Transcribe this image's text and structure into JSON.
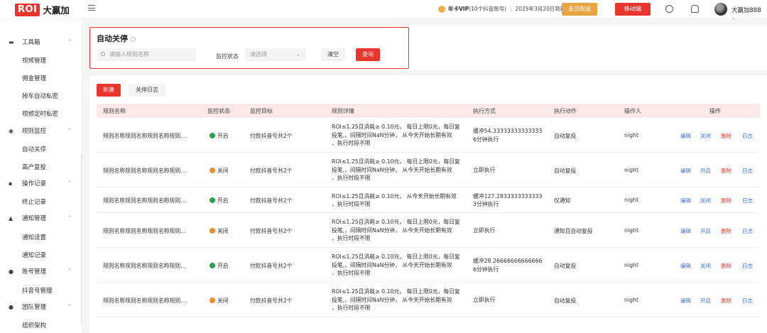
{
  "header": {
    "logo_badge": "ROI",
    "logo_text": "大赢加",
    "vip_label": "年卡VIP",
    "vip_accounts": "(10个抖音账号)",
    "vip_expiry": "2025年3月20日到期",
    "member_rights_btn": "会员权益",
    "mobile_btn": "移动端",
    "username": "大赢加888"
  },
  "sidebar": {
    "groups": [
      {
        "label": "工具箱",
        "items": [
          "视频管理",
          "佣金管理",
          "掉车自动私密",
          "视频定时私密"
        ]
      },
      {
        "label": "规则监控",
        "items": [
          "自动关停",
          "高产复投"
        ]
      },
      {
        "label": "操作记录",
        "items": [
          "终止记录"
        ]
      },
      {
        "label": "通知管理",
        "items": [
          "通知设置",
          "通知记录"
        ]
      },
      {
        "label": "账号管理",
        "items": [
          "抖音号管理"
        ]
      },
      {
        "label": "团队管理",
        "items": [
          "组织架构"
        ]
      }
    ]
  },
  "filter": {
    "title": "自动关停",
    "search_placeholder": "请输入规则名称",
    "status_label": "监控状态",
    "status_placeholder": "请选择",
    "clear_btn": "清空",
    "query_btn": "查询"
  },
  "toolbar": {
    "new_btn": "新建",
    "log_btn": "关停日志"
  },
  "table": {
    "headers": [
      "规则名称",
      "监控状态",
      "监控目标",
      "规则详情",
      "执行方式",
      "执行动作",
      "操作人",
      "操作"
    ],
    "rows": [
      {
        "name": "规则名称规则名称规则名称规则...",
        "status": "开启",
        "status_on": true,
        "target": "付款抖音号共2个",
        "detail_lines": [
          "ROI≤1.25且消耗≥ 0.10元， 每日上限0元，每日复",
          "投笔,，间隔时间NaN分钟， 从今天开始长期有效",
          "，执行时段不限"
        ],
        "exec_lines": [
          "缓冲54.33333333333333",
          "6分钟执行"
        ],
        "action": "自动复投",
        "operator": "night",
        "ops": [
          "编辑",
          "关闭",
          "删除",
          "日志"
        ]
      },
      {
        "name": "规则名称规则名称规则名称规则...",
        "status": "关闭",
        "status_on": false,
        "target": "付款抖音号共2个",
        "detail_lines": [
          "ROI≤1.25且消耗≥ 0.10元， 每日上限0元，每日复",
          "投笔,，间隔时间NaN分钟， 从今天开始长期有效",
          "，执行时段不限"
        ],
        "exec_lines": [
          "立即执行"
        ],
        "action": "自动复投",
        "operator": "night",
        "ops": [
          "编辑",
          "开启",
          "删除",
          "日志"
        ]
      },
      {
        "name": "规则名称规则名称规则名称规则...",
        "status": "开启",
        "status_on": true,
        "target": "付款抖音号共2个",
        "detail_lines": [
          "ROI≤1.25且消耗≥ 0.10元， 从今天开始长期有效",
          "，执行时段不限"
        ],
        "exec_lines": [
          "缓冲127.2833333333333",
          "3分钟执行"
        ],
        "action": "仅通知",
        "operator": "night",
        "ops": [
          "编辑",
          "关闭",
          "删除",
          "日志"
        ]
      },
      {
        "name": "规则名称规则名称规则名称规则...",
        "status": "关闭",
        "status_on": false,
        "target": "付款抖音号共2个",
        "detail_lines": [
          "ROI≤1.25且消耗≥ 0.10元， 每日上限0元，每日复",
          "投笔,，间隔时间NaN分钟， 从今天开始长期有效",
          "，执行时段不限"
        ],
        "exec_lines": [
          "立即执行"
        ],
        "action": "通知且自动复投",
        "operator": "night",
        "ops": [
          "编辑",
          "开启",
          "删除",
          "日志"
        ]
      },
      {
        "name": "规则名称规则名称规则名称规则...",
        "status": "开启",
        "status_on": true,
        "target": "付款抖音号共2个",
        "detail_lines": [
          "ROI≤1.25且消耗≥ 0.10元， 每日上限0元，每日复",
          "投笔,，间隔时间NaN分钟， 从今天开始长期有效",
          "，执行时段不限"
        ],
        "exec_lines": [
          "缓冲28.26666666666666",
          "6分钟执行"
        ],
        "action": "自动复投",
        "operator": "night",
        "ops": [
          "编辑",
          "关闭",
          "删除",
          "日志"
        ]
      },
      {
        "name": "规则名称规则名称规则名称规则...",
        "status": "关闭",
        "status_on": false,
        "target": "付款抖音号共2个",
        "detail_lines": [
          "ROI≤1.25且消耗≥ 0.10元， 每日上限0元，每日复",
          "投笔,，间隔时间NaN分钟， 从今天开始长期有效",
          "，执行时段不限"
        ],
        "exec_lines": [
          "立即执行"
        ],
        "action": "自动复投",
        "operator": "night",
        "ops": [
          "编辑",
          "开启",
          "删除",
          "日志"
        ]
      }
    ]
  },
  "colors": {
    "brand_red": "#e8352e",
    "status_on": "#2e9e4e",
    "status_off": "#ee8a2a",
    "link_blue": "#3f6fd8"
  }
}
